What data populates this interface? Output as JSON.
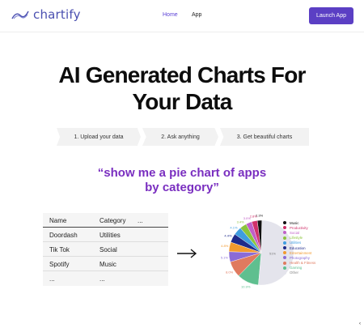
{
  "header": {
    "brand": "chartify",
    "nav": [
      {
        "label": "Home",
        "active": true
      },
      {
        "label": "App",
        "active": false
      }
    ],
    "cta_label": "Launch App"
  },
  "hero": {
    "line1": "AI Generated Charts For",
    "line2": "Your Data"
  },
  "steps": [
    "1. Upload your data",
    "2. Ask anything",
    "3. Get beautiful charts"
  ],
  "prompt": {
    "line1": "“show me a pie chart of apps",
    "line2": "by category”"
  },
  "table": {
    "columns": [
      "Name",
      "Category",
      "..."
    ],
    "rows": [
      [
        "Doordash",
        "Utilities"
      ],
      [
        "Tik Tok",
        "Social"
      ],
      [
        "Spotify",
        "Music"
      ],
      [
        "...",
        "..."
      ]
    ]
  },
  "chart_data": {
    "type": "pie",
    "categories": [
      "Music",
      "Productivity",
      "Social",
      "Lifestyle",
      "Utilities",
      "Education",
      "Entertainment",
      "Photography",
      "Health & Fitness",
      "Gaming",
      "Other"
    ],
    "values": [
      2.3,
      2.8,
      3.0,
      3.4,
      4.1,
      4.4,
      4.8,
      5.1,
      8.0,
      10.9,
      51
    ],
    "slice_labels": [
      "2.3%",
      "2.8%",
      "3.0%",
      "3.4%",
      "4.1%",
      "4.4%",
      "4.8%",
      "5.1%",
      "8.0%",
      "10.9%",
      "51%"
    ],
    "colors": [
      "#111111",
      "#d0306a",
      "#c060c8",
      "#8cc43c",
      "#3f9de0",
      "#1f2a8a",
      "#f29a2e",
      "#8a6bd6",
      "#e07a5f",
      "#5fbf8f",
      "#e4e4ec"
    ],
    "legend": "right"
  },
  "pager": "‹"
}
